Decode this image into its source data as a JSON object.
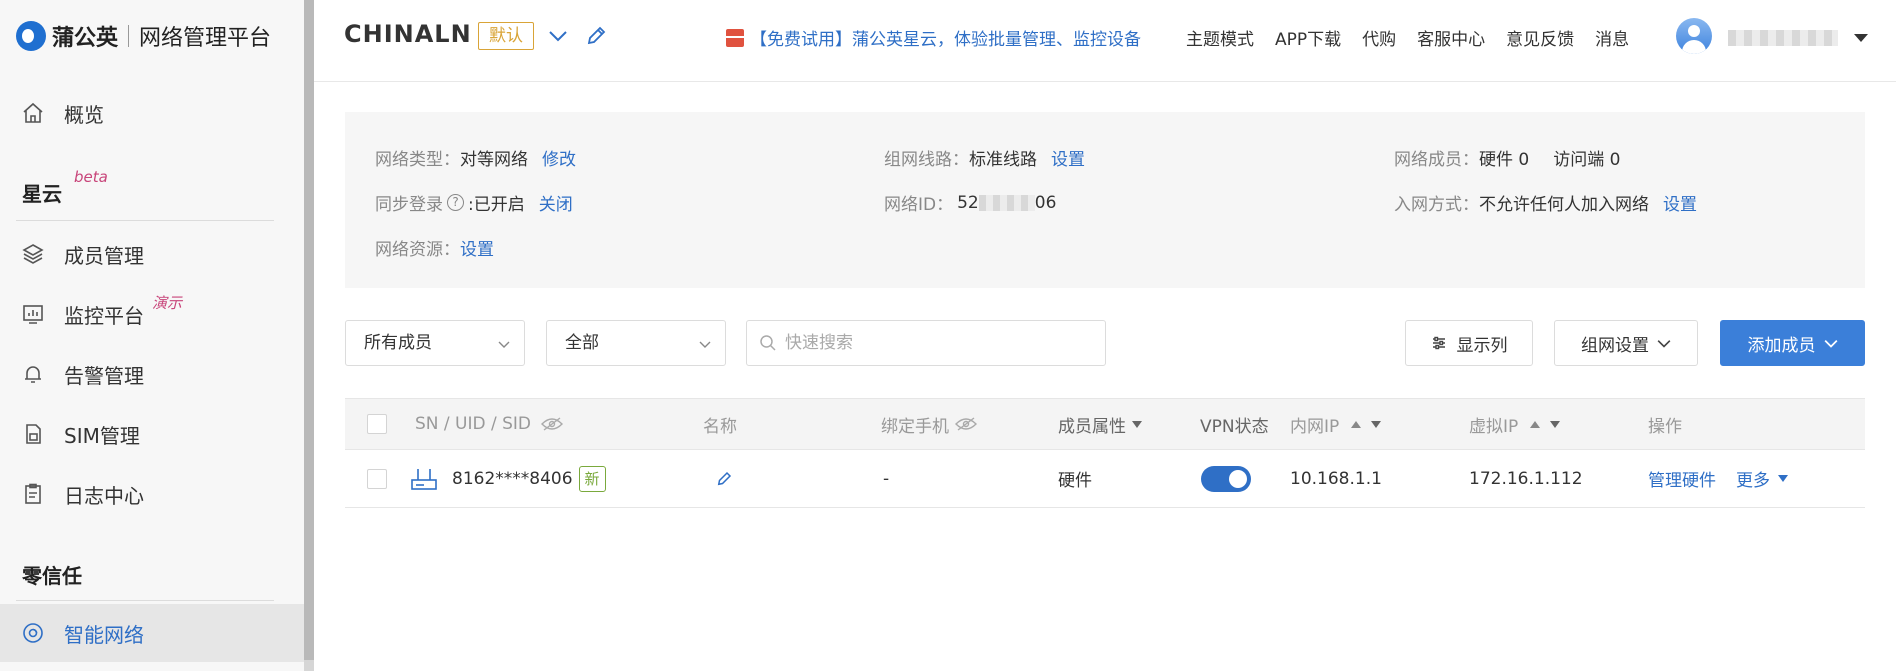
{
  "logo": {
    "brand": "蒲公英",
    "subtitle": "网络管理平台"
  },
  "sidebar": {
    "items": [
      {
        "label": "概览"
      },
      {
        "label": "成员管理"
      },
      {
        "label": "监控平台"
      },
      {
        "label": "告警管理"
      },
      {
        "label": "SIM管理"
      },
      {
        "label": "日志中心"
      },
      {
        "label": "智能网络"
      }
    ],
    "section_xingyun": "星云",
    "section_xingyun_tag": "beta",
    "monitor_tag": "演示",
    "section_zero_trust": "零信任"
  },
  "header": {
    "network_name": "CHINALN",
    "default_badge": "默认",
    "promo": "【免费试用】蒲公英星云，体验批量管理、监控设备",
    "links": [
      "主题模式",
      "APP下载",
      "代购",
      "客服中心",
      "意见反馈",
      "消息"
    ]
  },
  "info": {
    "network_type_label": "网络类型：",
    "network_type_value": "对等网络",
    "network_type_action": "修改",
    "route_label": "组网线路：",
    "route_value": "标准线路",
    "route_action": "设置",
    "members_label": "网络成员：",
    "members_hw": "硬件 0",
    "members_visitor": "访问端 0",
    "sync_label": "同步登录",
    "sync_value": ":已开启",
    "sync_action": "关闭",
    "netid_label": "网络ID：",
    "netid_prefix": "52",
    "netid_suffix": "06",
    "join_label": "入网方式：",
    "join_value": "不允许任何人加入网络",
    "join_action": "设置",
    "resource_label": "网络资源：",
    "resource_action": "设置"
  },
  "filters": {
    "member_select": "所有成员",
    "status_select": "全部",
    "search_placeholder": "快速搜索",
    "columns_button": "显示列",
    "network_settings_button": "组网设置",
    "add_member_button": "添加成员"
  },
  "table": {
    "headers": {
      "sn": "SN / UID / SID",
      "name": "名称",
      "phone": "绑定手机",
      "attr": "成员属性",
      "vpn": "VPN状态",
      "lan_ip": "内网IP",
      "virtual_ip": "虚拟IP",
      "ops": "操作"
    },
    "rows": [
      {
        "sn": "8162****8406",
        "badge": "新",
        "phone": "-",
        "attr": "硬件",
        "vpn_on": true,
        "lan_ip": "10.168.1.1",
        "virtual_ip": "172.16.1.112",
        "manage": "管理硬件",
        "more": "更多"
      }
    ]
  },
  "colors": {
    "accent": "#2f6fc6",
    "primary_button": "#3b7fd9",
    "badge_default": "#d9a437",
    "badge_new": "#7aa93c",
    "beta_tag": "#c8457a"
  }
}
